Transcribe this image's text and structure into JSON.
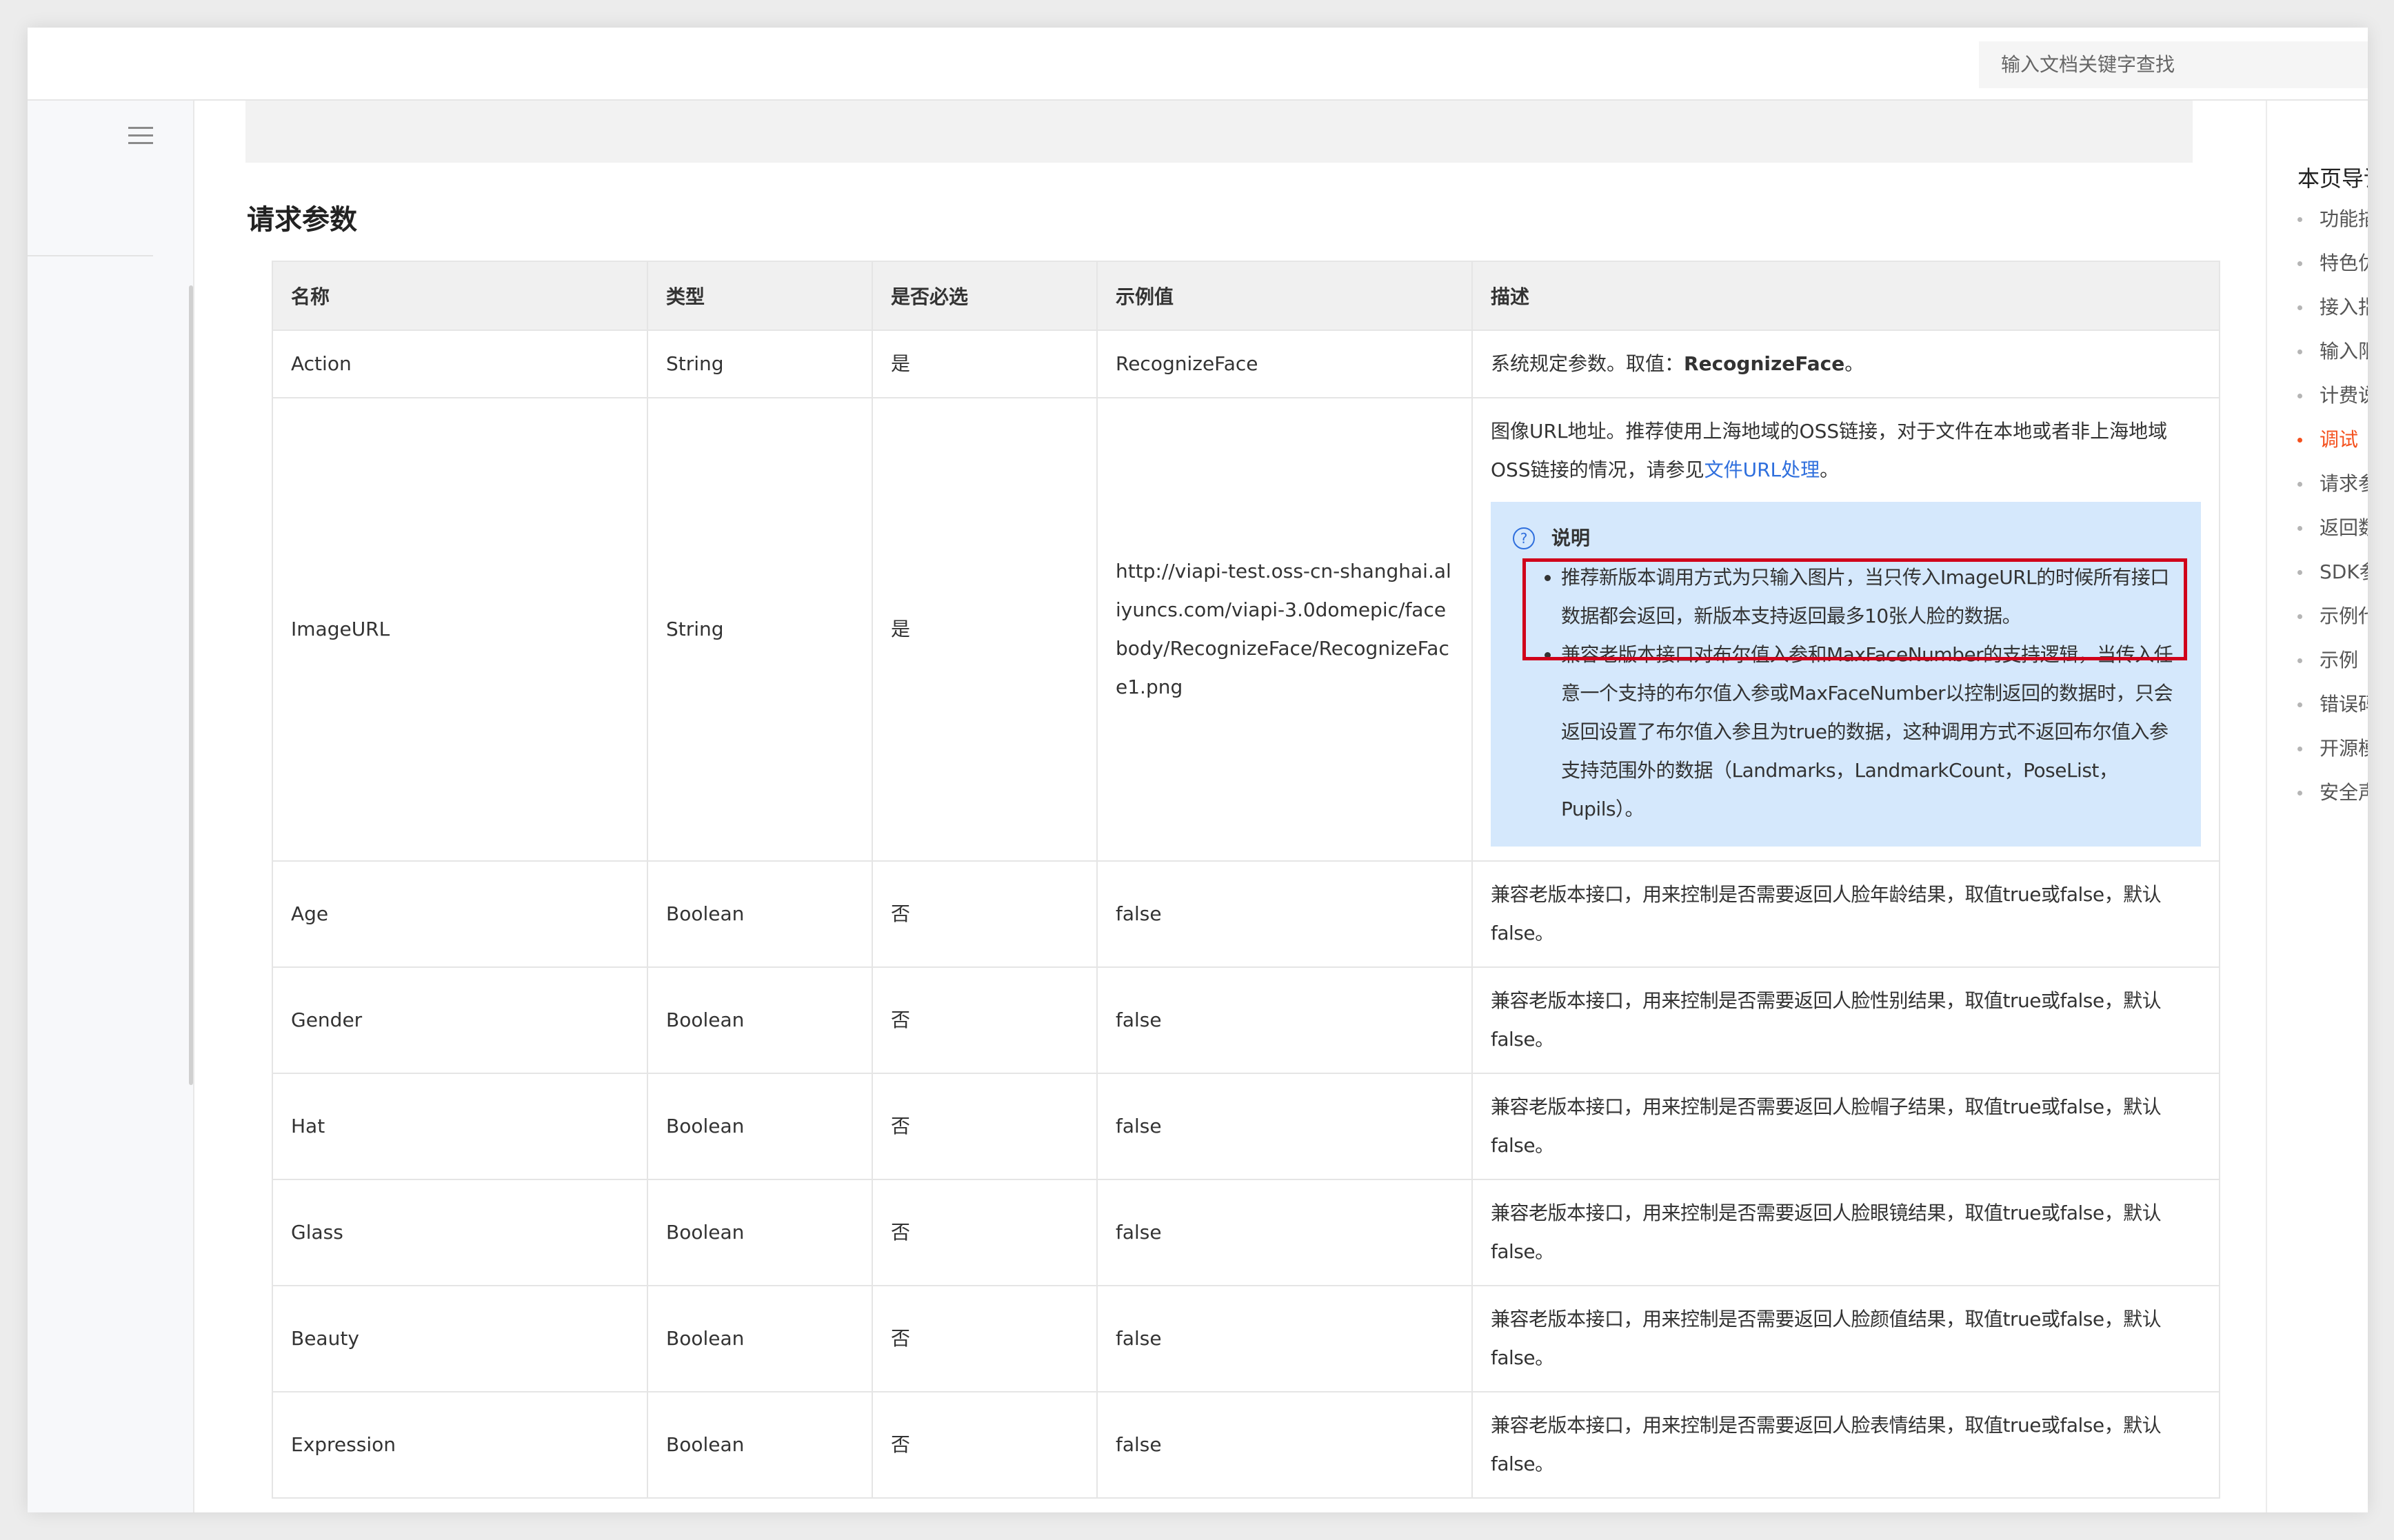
{
  "search": {
    "placeholder": "输入文档关键字查找"
  },
  "section": {
    "title": "请求参数"
  },
  "table": {
    "headers": [
      "名称",
      "类型",
      "是否必选",
      "示例值",
      "描述"
    ],
    "rows": [
      {
        "name": "Action",
        "type": "String",
        "required": "是",
        "example": "RecognizeFace",
        "desc_prefix": "系统规定参数。取值：",
        "desc_bold": "RecognizeFace",
        "desc_suffix": "。"
      },
      {
        "name": "ImageURL",
        "type": "String",
        "required": "是",
        "example": "http://viapi-test.oss-cn-shanghai.aliyuncs.com/viapi-3.0domepic/facebody/RecognizeFace/RecognizeFace1.png",
        "desc_text": "图像URL地址。推荐使用上海地域的OSS链接，对于文件在本地或者非上海地域OSS链接的情况，请参见",
        "desc_link": "文件URL处理",
        "desc_end": "。",
        "note_title": "说明",
        "note_items": [
          "推荐新版本调用方式为只输入图片，当只传入ImageURL的时候所有接口数据都会返回，新版本支持返回最多10张人脸的数据。",
          "兼容老版本接口对布尔值入参和MaxFaceNumber的支持逻辑，当传入任意一个支持的布尔值入参或MaxFaceNumber以控制返回的数据时，只会返回设置了布尔值入参且为true的数据，这种调用方式不返回布尔值入参支持范围外的数据（Landmarks，LandmarkCount，PoseList，Pupils）。"
        ]
      },
      {
        "name": "Age",
        "type": "Boolean",
        "required": "否",
        "example": "false",
        "desc": "兼容老版本接口，用来控制是否需要返回人脸年龄结果，取值true或false，默认false。"
      },
      {
        "name": "Gender",
        "type": "Boolean",
        "required": "否",
        "example": "false",
        "desc": "兼容老版本接口，用来控制是否需要返回人脸性别结果，取值true或false，默认false。"
      },
      {
        "name": "Hat",
        "type": "Boolean",
        "required": "否",
        "example": "false",
        "desc": "兼容老版本接口，用来控制是否需要返回人脸帽子结果，取值true或false，默认false。"
      },
      {
        "name": "Glass",
        "type": "Boolean",
        "required": "否",
        "example": "false",
        "desc": "兼容老版本接口，用来控制是否需要返回人脸眼镜结果，取值true或false，默认false。"
      },
      {
        "name": "Beauty",
        "type": "Boolean",
        "required": "否",
        "example": "false",
        "desc": "兼容老版本接口，用来控制是否需要返回人脸颜值结果，取值true或false，默认false。"
      },
      {
        "name": "Expression",
        "type": "Boolean",
        "required": "否",
        "example": "false",
        "desc": "兼容老版本接口，用来控制是否需要返回人脸表情结果，取值true或false，默认false。"
      }
    ]
  },
  "toc": {
    "title": "本页导读",
    "items": [
      "功能描述",
      "特色优势",
      "接入指引",
      "输入限制",
      "计费说明",
      "调试",
      "请求参数",
      "返回数据",
      "SDK参考",
      "示例代码",
      "示例",
      "错误码",
      "开源模型",
      "安全声明"
    ],
    "active_index": 5
  },
  "colors": {
    "accent_link": "#2f6fdd",
    "toc_active": "#f4511e",
    "highlight_frame": "#d0021b",
    "note_bg": "#d5e8fc"
  },
  "icons": {
    "menu": "hamburger-icon",
    "note": "question-circle-icon"
  }
}
